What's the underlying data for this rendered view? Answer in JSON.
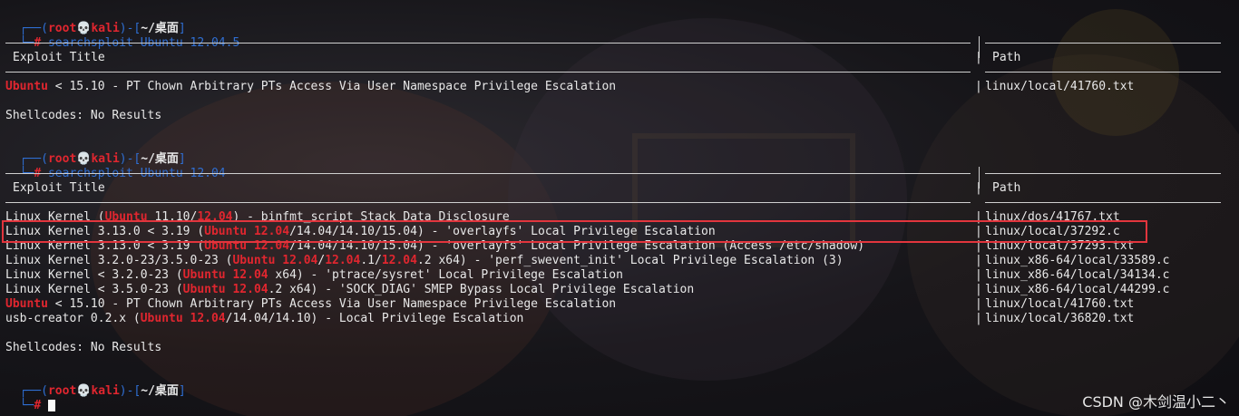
{
  "prompts": [
    {
      "user": "root",
      "host": "kali",
      "skull": "💀",
      "dir": "~/桌面",
      "cmd": "searchsploit Ubuntu 12.04.5"
    },
    {
      "user": "root",
      "host": "kali",
      "skull": "💀",
      "dir": "~/桌面",
      "cmd": "searchsploit Ubuntu 12.04"
    },
    {
      "user": "root",
      "host": "kali",
      "skull": "💀",
      "dir": "~/桌面",
      "cmd": ""
    }
  ],
  "headers": {
    "title": "Exploit Title",
    "path": "Path"
  },
  "shellcodes": "Shellcodes: No Results",
  "results1": [
    {
      "parts": [
        {
          "t": "Ubuntu",
          "h": true
        },
        {
          "t": " < 15.10 - PT Chown Arbitrary PTs Access Via User Namespace Privilege Escalation",
          "h": false
        }
      ],
      "path": "linux/local/41760.txt"
    }
  ],
  "results2": [
    {
      "parts": [
        {
          "t": "Linux Kernel (",
          "h": false
        },
        {
          "t": "Ubuntu",
          "h": true
        },
        {
          "t": " 11.10/",
          "h": false
        },
        {
          "t": "12.04",
          "h": true
        },
        {
          "t": ") - binfmt_script Stack Data Disclosure",
          "h": false
        }
      ],
      "path": "linux/dos/41767.txt"
    },
    {
      "parts": [
        {
          "t": "Linux Kernel 3.13.0 < 3.19 (",
          "h": false
        },
        {
          "t": "Ubuntu 12.04",
          "h": true
        },
        {
          "t": "/14.04/14.10/15.04) - 'overlayfs' Local Privilege Escalation",
          "h": false
        }
      ],
      "path": "linux/local/37292.c"
    },
    {
      "parts": [
        {
          "t": "Linux Kernel 3.13.0 < 3.19 (",
          "h": false
        },
        {
          "t": "Ubuntu 12.04",
          "h": true
        },
        {
          "t": "/14.04/14.10/15.04) - 'overlayfs' Local Privilege Escalation (Access /etc/shadow)",
          "h": false
        }
      ],
      "path": "linux/local/37293.txt"
    },
    {
      "parts": [
        {
          "t": "Linux Kernel 3.2.0-23/3.5.0-23 (",
          "h": false
        },
        {
          "t": "Ubuntu 12.04",
          "h": true
        },
        {
          "t": "/",
          "h": false
        },
        {
          "t": "12.04",
          "h": true
        },
        {
          "t": ".1/",
          "h": false
        },
        {
          "t": "12.04",
          "h": true
        },
        {
          "t": ".2 x64) - 'perf_swevent_init' Local Privilege Escalation (3)",
          "h": false
        }
      ],
      "path": "linux_x86-64/local/33589.c"
    },
    {
      "parts": [
        {
          "t": "Linux Kernel < 3.2.0-23 (",
          "h": false
        },
        {
          "t": "Ubuntu 12.04",
          "h": true
        },
        {
          "t": " x64) - 'ptrace/sysret' Local Privilege Escalation",
          "h": false
        }
      ],
      "path": "linux_x86-64/local/34134.c"
    },
    {
      "parts": [
        {
          "t": "Linux Kernel < 3.5.0-23 (",
          "h": false
        },
        {
          "t": "Ubuntu 12.04",
          "h": true
        },
        {
          "t": ".2 x64) - 'SOCK_DIAG' SMEP Bypass Local Privilege Escalation",
          "h": false
        }
      ],
      "path": "linux_x86-64/local/44299.c"
    },
    {
      "parts": [
        {
          "t": "Ubuntu",
          "h": true
        },
        {
          "t": " < 15.10 - PT Chown Arbitrary PTs Access Via User Namespace Privilege Escalation",
          "h": false
        }
      ],
      "path": "linux/local/41760.txt"
    },
    {
      "parts": [
        {
          "t": "usb-creator 0.2.x (",
          "h": false
        },
        {
          "t": "Ubuntu 12.04",
          "h": true
        },
        {
          "t": "/14.04/14.10) - Local Privilege Escalation",
          "h": false
        }
      ],
      "path": "linux/local/36820.txt"
    }
  ],
  "watermark": "CSDN @木剑温小二丶",
  "colors": {
    "accent": "#2f6fd4",
    "highlight": "#e0262f",
    "box": "#e2353d"
  }
}
